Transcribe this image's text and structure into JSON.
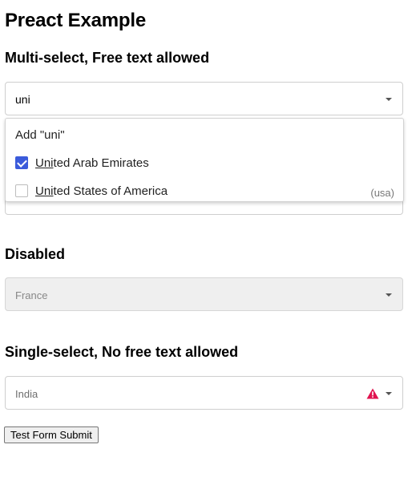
{
  "page": {
    "title": "Preact Example"
  },
  "multi": {
    "heading": "Multi-select, Free text allowed",
    "input_value": "uni",
    "dropdown": {
      "add_option": "Add \"uni\"",
      "options": [
        {
          "match": "Uni",
          "rest": "ted Arab Emirates",
          "checked": true,
          "extra": ""
        },
        {
          "match": "Uni",
          "rest": "ted States of America",
          "checked": false,
          "extra": "(usa)"
        }
      ]
    }
  },
  "disabled": {
    "heading": "Disabled",
    "value": "France"
  },
  "single": {
    "heading": "Single-select, No free text allowed",
    "placeholder": "India",
    "warning_color": "#e0134f"
  },
  "form": {
    "submit_label": "Test Form Submit"
  },
  "colors": {
    "checkbox_accent": "#3b5bdb"
  }
}
